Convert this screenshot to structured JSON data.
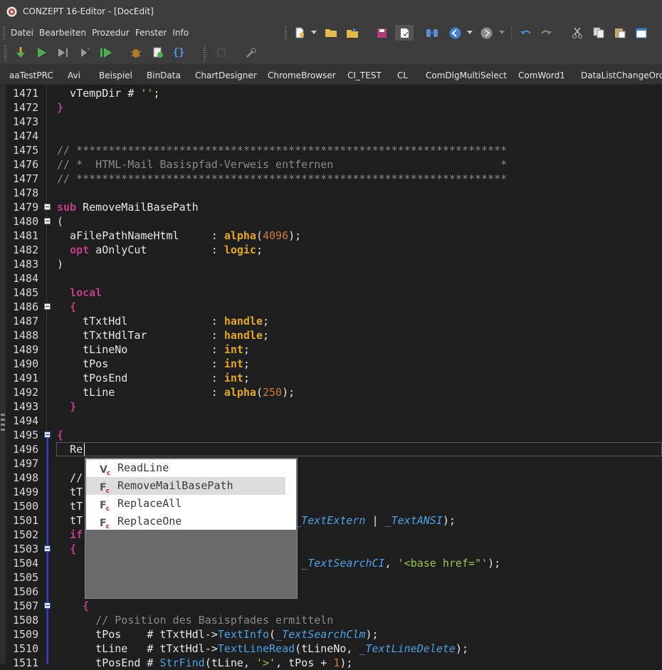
{
  "window": {
    "title": "CONZEPT 16-Editor - [DocEdit]"
  },
  "menu": [
    "Datei",
    "Bearbeiten",
    "Prozedur",
    "Fenster",
    "Info"
  ],
  "tabs": [
    "aaTestPRC",
    "Avi",
    "Beispiel",
    "BinData",
    "ChartDesigner",
    "ChromeBrowser",
    "CI_TEST",
    "CL",
    "ComDlgMultiSelect",
    "ComWord1",
    "DataListChangeOrder"
  ],
  "toolbar_icons": {
    "row1": [
      "new-doc-icon",
      "open-folder-icon",
      "open-recent-icon",
      "save-icon",
      "checkout-icon",
      "find-icon",
      "nav-back-icon",
      "nav-forward-icon",
      "undo-icon",
      "redo-icon",
      "cut-icon",
      "copy-icon",
      "paste-icon",
      "calendar-icon"
    ],
    "row2": [
      "compile-icon",
      "run-icon",
      "step-icon",
      "step-into-icon",
      "run-all-icon",
      "debug-icon",
      "check-icon",
      "braces-icon",
      "breakpoint-icon",
      "tools-icon"
    ]
  },
  "code_lines": [
    {
      "n": "1471",
      "html": "  vTempDir # <span class=\"str\">''</span>;"
    },
    {
      "n": "1472",
      "html": "<span class=\"kw\">}</span>"
    },
    {
      "n": "1473",
      "html": ""
    },
    {
      "n": "1474",
      "html": ""
    },
    {
      "n": "1475",
      "html": "<span class=\"cm\">// *******************************************************************</span>"
    },
    {
      "n": "1476",
      "html": "<span class=\"cm\">// *  HTML-Mail Basispfad-Verweis entfernen                          *</span>"
    },
    {
      "n": "1477",
      "html": "<span class=\"cm\">// *******************************************************************</span>"
    },
    {
      "n": "1478",
      "html": ""
    },
    {
      "n": "1479",
      "html": "<span class=\"kw\">sub</span> RemoveMailBasePath",
      "fold": true
    },
    {
      "n": "1480",
      "html": "(",
      "fold": true
    },
    {
      "n": "1481",
      "html": "  aFilePathNameHtml     : <span class=\"ty\">alpha</span>(<span class=\"num\">4096</span>);"
    },
    {
      "n": "1482",
      "html": "  <span class=\"kw\">opt</span> aOnlyCut          : <span class=\"ty\">logic</span>;"
    },
    {
      "n": "1483",
      "html": ")"
    },
    {
      "n": "1484",
      "html": ""
    },
    {
      "n": "1485",
      "html": "  <span class=\"kw\">local</span>"
    },
    {
      "n": "1486",
      "html": "  <span class=\"kw\">{</span>",
      "fold": true
    },
    {
      "n": "1487",
      "html": "    tTxtHdl             : <span class=\"ty\">handle</span>;"
    },
    {
      "n": "1488",
      "html": "    tTxtHdlTar          : <span class=\"ty\">handle</span>;"
    },
    {
      "n": "1489",
      "html": "    tLineNo             : <span class=\"ty\">int</span>;"
    },
    {
      "n": "1490",
      "html": "    tPos                : <span class=\"ty\">int</span>;"
    },
    {
      "n": "1491",
      "html": "    tPosEnd             : <span class=\"ty\">int</span>;"
    },
    {
      "n": "1492",
      "html": "    tLine               : <span class=\"ty\">alpha</span>(<span class=\"num\">250</span>);"
    },
    {
      "n": "1493",
      "html": "  <span class=\"kw\">}</span>"
    },
    {
      "n": "1494",
      "html": ""
    },
    {
      "n": "1495",
      "html": "<span class=\"kw\">{</span>",
      "fold": true,
      "sel": true
    },
    {
      "n": "1496",
      "html": "  Re"
    },
    {
      "n": "1497",
      "html": ""
    },
    {
      "n": "1498",
      "html": "  //"
    },
    {
      "n": "1499",
      "html": "  tT"
    },
    {
      "n": "1500",
      "html": "  tT"
    },
    {
      "n": "1501",
      "html": "  tT                            tml, <span class=\"const\">_TextExtern</span> | <span class=\"const\">_TextANSI</span>);"
    },
    {
      "n": "1502",
      "html": "  <span class=\"kw\">if</span>"
    },
    {
      "n": "1503",
      "html": "  <span class=\"kw\">{</span>",
      "fold": true,
      "sel": true
    },
    {
      "n": "1504",
      "html": "                                <span class=\"num\">1</span>, <span class=\"num\">1</span>, <span class=\"const\">_TextSearchCI</span>, <span class=\"str\">'&lt;base href=\"'</span>);"
    },
    {
      "n": "1505",
      "html": ""
    },
    {
      "n": "1506",
      "html": ""
    },
    {
      "n": "1507",
      "html": "    <span class=\"kw\">{</span>",
      "fold": true,
      "sel": true
    },
    {
      "n": "1508",
      "html": "      <span class=\"cm\">// Position des Basispfades ermitteln</span>"
    },
    {
      "n": "1509",
      "html": "      tPos    # tTxtHdl-><span class=\"fn\">TextInfo</span>(<span class=\"const\">_TextSearchClm</span>);"
    },
    {
      "n": "1510",
      "html": "      tLine   # tTxtHdl-><span class=\"fn\">TextLineRead</span>(tLineNo, <span class=\"const\">_TextLineDelete</span>);"
    },
    {
      "n": "1511",
      "html": "      tPosEnd # <span class=\"fn\">StrFind</span>(tLine, <span class=\"str\">'>'</span>, tPos + <span class=\"num\">1</span>);"
    }
  ],
  "autocomplete": {
    "items": [
      {
        "label": "ReadLine",
        "icon": "variable-icon",
        "letter": "V"
      },
      {
        "label": "RemoveMailBasePath",
        "icon": "function-icon",
        "letter": "F",
        "selected": true
      },
      {
        "label": "ReplaceAll",
        "icon": "function-icon",
        "letter": "F"
      },
      {
        "label": "ReplaceOne",
        "icon": "function-icon",
        "letter": "F"
      }
    ]
  }
}
